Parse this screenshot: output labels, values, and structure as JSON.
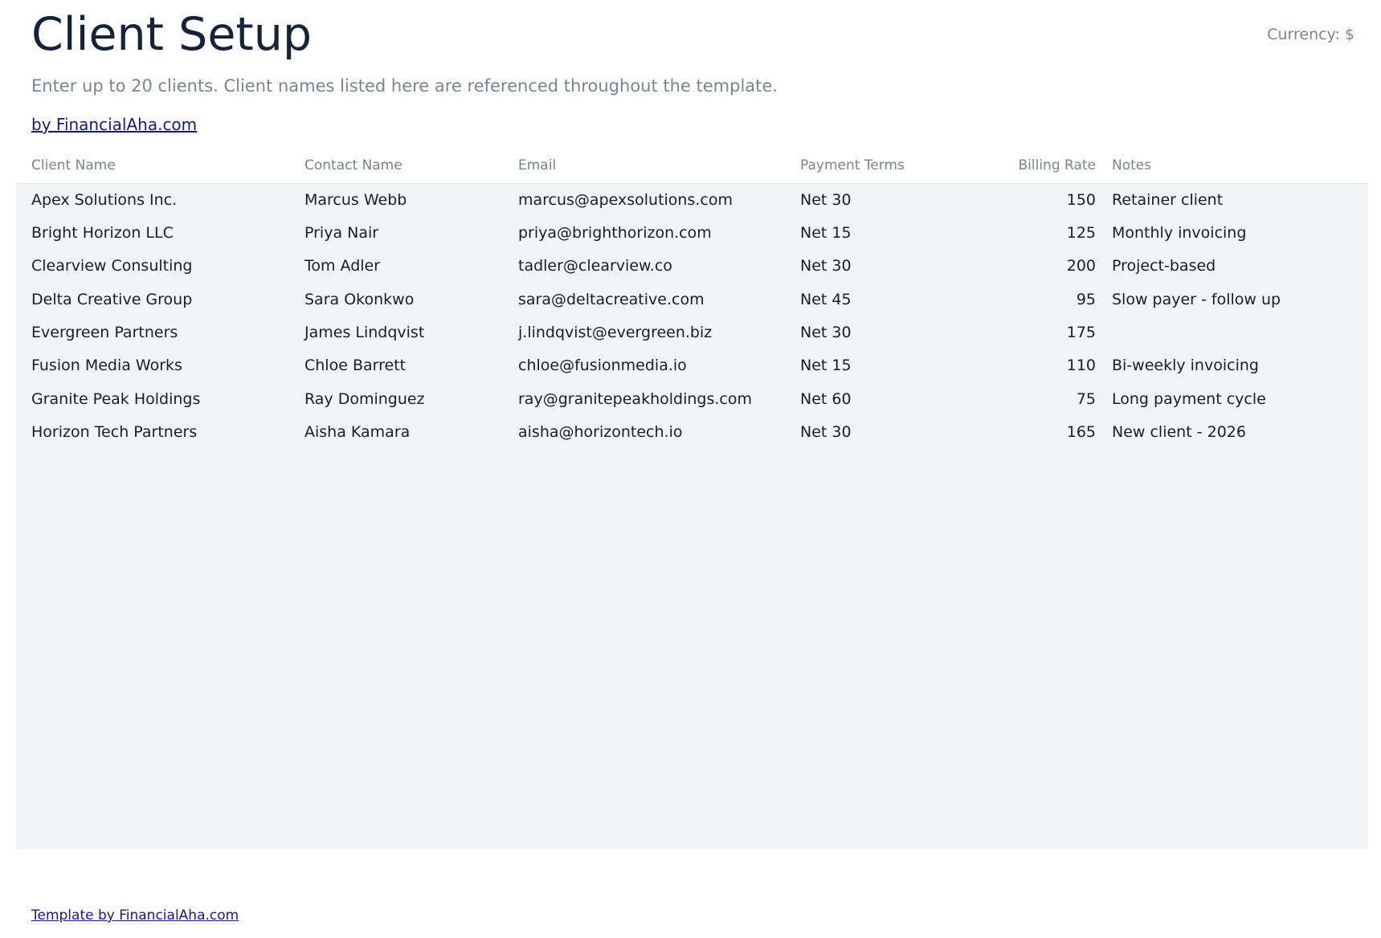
{
  "header": {
    "title": "Client Setup",
    "currency": "Currency: $",
    "subtitle": "Enter up to 20 clients. Client names listed here are referenced throughout the template.",
    "brand_link": "by FinancialAha.com"
  },
  "table": {
    "columns": {
      "client_name": "Client Name",
      "contact_name": "Contact Name",
      "email": "Email",
      "payment_terms": "Payment Terms",
      "billing_rate": "Billing Rate",
      "notes": "Notes"
    },
    "rows": [
      {
        "client_name": "Apex Solutions Inc.",
        "contact_name": "Marcus Webb",
        "email": "marcus@apexsolutions.com",
        "payment_terms": "Net 30",
        "billing_rate": "150",
        "notes": "Retainer client"
      },
      {
        "client_name": "Bright Horizon LLC",
        "contact_name": "Priya Nair",
        "email": "priya@brighthorizon.com",
        "payment_terms": "Net 15",
        "billing_rate": "125",
        "notes": "Monthly invoicing"
      },
      {
        "client_name": "Clearview Consulting",
        "contact_name": "Tom Adler",
        "email": "tadler@clearview.co",
        "payment_terms": "Net 30",
        "billing_rate": "200",
        "notes": "Project-based"
      },
      {
        "client_name": "Delta Creative Group",
        "contact_name": "Sara Okonkwo",
        "email": "sara@deltacreative.com",
        "payment_terms": "Net 45",
        "billing_rate": "95",
        "notes": "Slow payer - follow up"
      },
      {
        "client_name": "Evergreen Partners",
        "contact_name": "James Lindqvist",
        "email": "j.lindqvist@evergreen.biz",
        "payment_terms": "Net 30",
        "billing_rate": "175",
        "notes": ""
      },
      {
        "client_name": "Fusion Media Works",
        "contact_name": "Chloe Barrett",
        "email": "chloe@fusionmedia.io",
        "payment_terms": "Net 15",
        "billing_rate": "110",
        "notes": "Bi-weekly invoicing"
      },
      {
        "client_name": "Granite Peak Holdings",
        "contact_name": "Ray Dominguez",
        "email": "ray@granitepeakholdings.com",
        "payment_terms": "Net 60",
        "billing_rate": "75",
        "notes": "Long payment cycle"
      },
      {
        "client_name": "Horizon Tech Partners",
        "contact_name": "Aisha Kamara",
        "email": "aisha@horizontech.io",
        "payment_terms": "Net 30",
        "billing_rate": "165",
        "notes": "New client - 2026"
      }
    ]
  },
  "footer": {
    "link": "Template by FinancialAha.com"
  }
}
